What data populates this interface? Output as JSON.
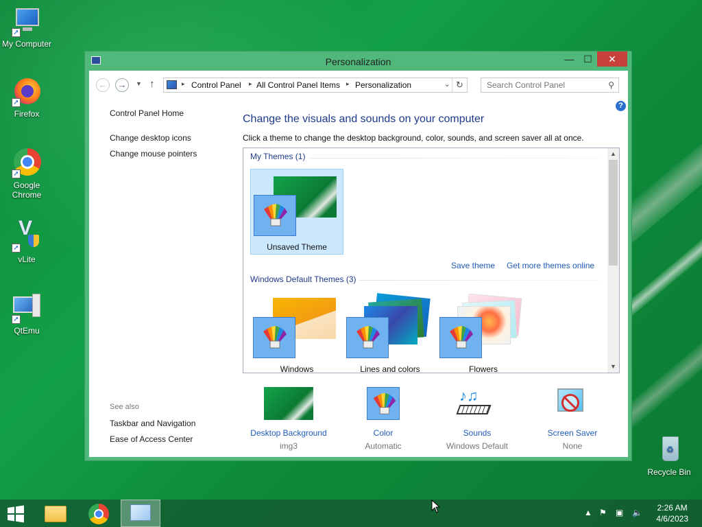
{
  "desktop": {
    "icons": [
      {
        "label": "My Computer"
      },
      {
        "label": "Firefox"
      },
      {
        "label": "Google Chrome"
      },
      {
        "label": "vLite"
      },
      {
        "label": "QtEmu"
      },
      {
        "label": "Recycle Bin"
      }
    ]
  },
  "window": {
    "title": "Personalization",
    "controls": {
      "minimize": "—",
      "maximize": "☐",
      "close": "✕"
    },
    "address": {
      "crumbs": [
        "Control Panel",
        "All Control Panel Items",
        "Personalization"
      ],
      "separator": "▸"
    },
    "search": {
      "placeholder": "Search Control Panel"
    },
    "left_pane": {
      "home": "Control Panel Home",
      "links": [
        "Change desktop icons",
        "Change mouse pointers"
      ],
      "see_also_title": "See also",
      "see_also": [
        "Taskbar and Navigation",
        "Ease of Access Center"
      ]
    },
    "content": {
      "heading": "Change the visuals and sounds on your computer",
      "subheading": "Click a theme to change the desktop background, color, sounds, and screen saver all at once.",
      "my_themes_title": "My Themes (1)",
      "my_themes": [
        {
          "name": "Unsaved Theme",
          "selected": true
        }
      ],
      "save_theme": "Save theme",
      "get_more": "Get more themes online",
      "default_themes_title": "Windows Default Themes (3)",
      "default_themes": [
        {
          "name": "Windows"
        },
        {
          "name": "Lines and colors"
        },
        {
          "name": "Flowers"
        }
      ]
    },
    "bottom": [
      {
        "label": "Desktop Background",
        "value": "img3"
      },
      {
        "label": "Color",
        "value": "Automatic"
      },
      {
        "label": "Sounds",
        "value": "Windows Default"
      },
      {
        "label": "Screen Saver",
        "value": "None"
      }
    ]
  },
  "taskbar": {
    "time": "2:26 AM",
    "date": "4/6/2023"
  },
  "colors": {
    "accent_green": "#4fb87a",
    "link_blue": "#1e5bb8",
    "selection": "#cce8ff"
  }
}
